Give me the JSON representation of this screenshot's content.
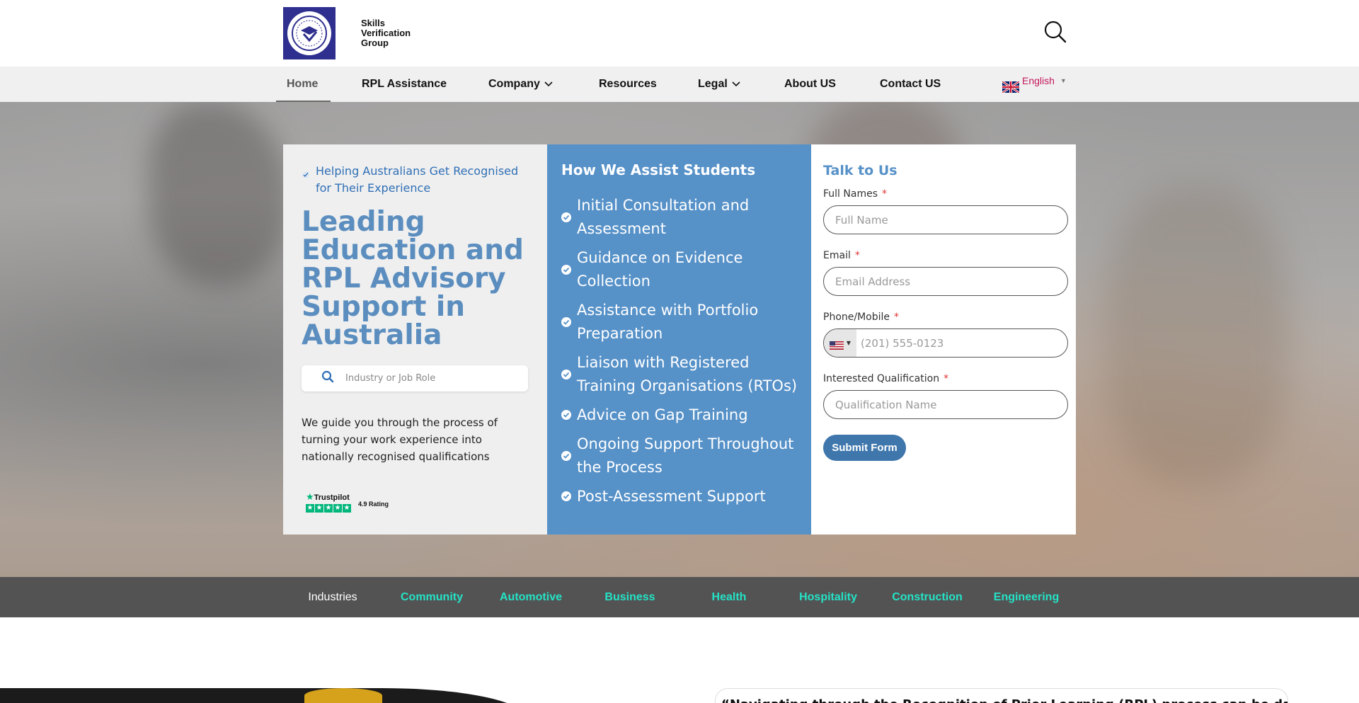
{
  "header": {
    "logo_alt": "skills-verification-group-logo",
    "logo_line1": "Skills",
    "logo_line2": "Verification",
    "logo_line3": "Group",
    "search_icon": "search-icon"
  },
  "nav": {
    "items": [
      {
        "label": "Home",
        "active": true
      },
      {
        "label": "RPL Assistance"
      },
      {
        "label": "Company",
        "dropdown": true
      },
      {
        "label": "Resources"
      },
      {
        "label": "Legal",
        "dropdown": true
      },
      {
        "label": "About US"
      },
      {
        "label": "Contact US"
      }
    ],
    "language": "English",
    "language_flag": "uk-flag-icon"
  },
  "hero": {
    "tagline": "Helping Australians Get Recognised for Their Experience",
    "title": "Leading Education and RPL Advisory Support in Australia",
    "search_placeholder": "Industry or Job Role",
    "description": "We guide you through the process of turning your work experience into nationally recognised qualifications",
    "trustpilot_label": "Trustpilot",
    "rating": "4.9 Rating"
  },
  "assist": {
    "title": "How We Assist Students",
    "items": [
      "Initial Consultation and Assessment",
      "Guidance on Evidence Collection",
      "Assistance with Portfolio Preparation",
      "Liaison with Registered Training Organisations (RTOs)",
      "Advice on Gap Training",
      "Ongoing Support Throughout the Process",
      "Post-Assessment Support"
    ]
  },
  "form": {
    "title": "Talk to Us",
    "full_name_label": "Full Names",
    "full_name_placeholder": "Full Name",
    "email_label": "Email",
    "email_placeholder": "Email Address",
    "phone_label": "Phone/Mobile",
    "phone_placeholder": "(201) 555-0123",
    "phone_flag": "us-flag-icon",
    "qualification_label": "Interested Qualification",
    "qualification_placeholder": "Qualification Name",
    "required_mark": "*",
    "submit_label": "Submit Form"
  },
  "industries": {
    "label": "Industries",
    "items": [
      "Community",
      "Automotive",
      "Business",
      "Health",
      "Hospitality",
      "Construction",
      "Engineering"
    ],
    "accent_color": "#24e3c6"
  },
  "below": {
    "quote_start": "“Navigating through the Recognition of Prior Learning (RPL) process can be daunting, but it"
  },
  "colors": {
    "brand_blue": "#5691c8",
    "logo_navy": "#2f2f8f",
    "submit_blue": "#3f77ad",
    "industries_bg": "#535353"
  }
}
